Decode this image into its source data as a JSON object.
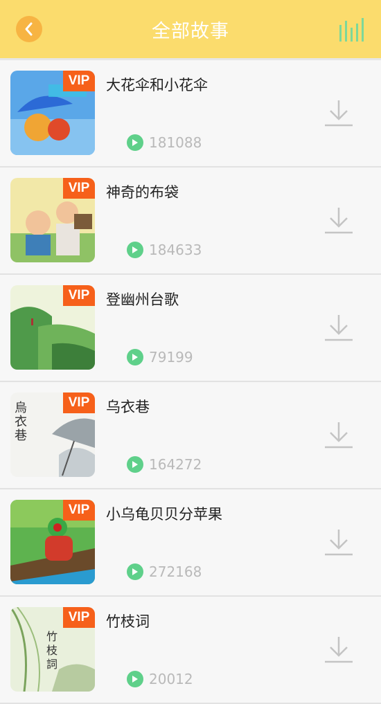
{
  "header": {
    "title": "全部故事",
    "back_icon": "chevron-left-icon",
    "right_icon": "equalizer-bars-icon",
    "colors": {
      "bar": "#fbdc6d",
      "back": "#f7b443",
      "bars_icon": "#7dd89a"
    }
  },
  "badge_label": "VIP",
  "stories": [
    {
      "title": "大花伞和小花伞",
      "plays": "181088",
      "art": "umbrella-cartoon"
    },
    {
      "title": "神奇的布袋",
      "plays": "184633",
      "art": "two-men-cartoon"
    },
    {
      "title": "登幽州台歌",
      "plays": "79199",
      "art": "green-cliff-painting"
    },
    {
      "title": "乌衣巷",
      "plays": "164272",
      "art": "ink-painting-swallows"
    },
    {
      "title": "小乌龟贝贝分苹果",
      "plays": "272168",
      "art": "turtle-on-boat"
    },
    {
      "title": "竹枝词",
      "plays": "20012",
      "art": "bamboo-ink-painting"
    }
  ]
}
